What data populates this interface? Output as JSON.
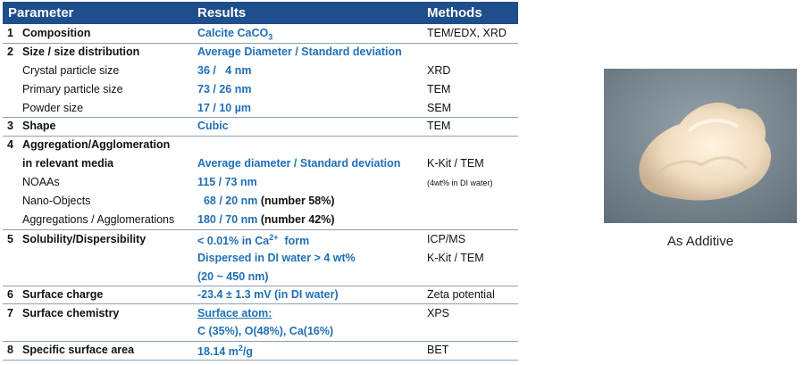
{
  "header": {
    "parameter": "Parameter",
    "results": "Results",
    "methods": "Methods"
  },
  "rows": [
    {
      "num": "1",
      "param": "Composition",
      "res": "Calcite CaCO",
      "res_sub": "3",
      "meth": "TEM/EDX, XRD"
    },
    {
      "num": "2",
      "param": "Size / size distribution",
      "res": "Average Diameter / Standard deviation",
      "meth": ""
    },
    {
      "num": "",
      "param": "Crystal particle size",
      "res": "36 /   4 nm",
      "meth": "XRD"
    },
    {
      "num": "",
      "param": "Primary particle size",
      "res": "73 / 26 nm",
      "meth": "TEM"
    },
    {
      "num": "",
      "param": "Powder size",
      "res": "17 / 10 µm",
      "meth": "SEM"
    },
    {
      "num": "3",
      "param": "Shape",
      "res": "Cubic",
      "meth": "TEM"
    },
    {
      "num": "4",
      "param": "Aggregation/Agglomeration",
      "res": "",
      "meth": ""
    },
    {
      "num": "",
      "param": "in relevant media",
      "res": "Average diameter / Standard deviation",
      "meth": "K-Kit / TEM"
    },
    {
      "num": "",
      "param": "NOAAs",
      "res": "115 / 73 nm",
      "meth": "(4wt% in DI water)"
    },
    {
      "num": "",
      "param": "Nano-Objects",
      "res": "  68 / 20 nm",
      "res_extra": " (number 58%)",
      "meth": ""
    },
    {
      "num": "",
      "param": "Aggregations / Agglomerations",
      "res": "180 / 70 nm",
      "res_extra": " (number 42%)",
      "meth": ""
    },
    {
      "num": "5",
      "param": "Solubility/Dispersibility",
      "res": "< 0.01% in Ca",
      "res_sup": "2+",
      "res_tail": "  form",
      "meth": "ICP/MS"
    },
    {
      "num": "",
      "param": "",
      "res": "Dispersed in DI water > 4 wt%",
      "meth": "K-Kit / TEM"
    },
    {
      "num": "",
      "param": "",
      "res": "(20 ~ 450 nm)",
      "meth": ""
    },
    {
      "num": "6",
      "param": "Surface charge",
      "res": "-23.4 ± 1.3 mV (in DI water)",
      "meth": "Zeta potential"
    },
    {
      "num": "7",
      "param": "Surface chemistry",
      "res": "Surface atom:",
      "meth": "XPS"
    },
    {
      "num": "",
      "param": "",
      "res": "C (35%), O(48%), Ca(16%)",
      "meth": ""
    },
    {
      "num": "8",
      "param": "Specific surface area",
      "res": "18.14 m",
      "res_sup": "2",
      "res_tail": "/g",
      "meth": "BET"
    }
  ],
  "caption": "As Additive"
}
